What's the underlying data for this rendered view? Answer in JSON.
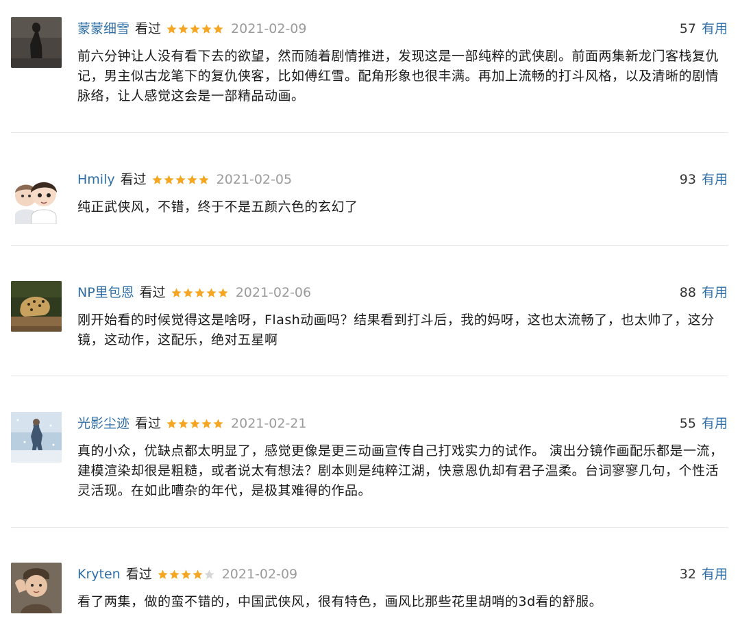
{
  "colors": {
    "link": "#2e6ea6",
    "date": "#9b9b9b",
    "star_on": "#f5a623",
    "star_off": "#d6d6d6"
  },
  "reviews": [
    {
      "username": "蒙蒙细雪",
      "status": "看过",
      "rating": 5,
      "date": "2021-02-09",
      "votes": "57",
      "useful_label": "有用",
      "content": "前六分钟让人没有看下去的欲望，然而随着剧情推进，发现这是一部纯粹的武侠剧。前面两集新龙门客栈复仇记，男主似古龙笔下的复仇侠客，比如傅红雪。配角形象也很丰满。再加上流畅的打斗风格，以及清晰的剧情脉络，让人感觉这会是一部精品动画。",
      "avatar_icon": "dark-figure-avatar"
    },
    {
      "username": "Hmily",
      "status": "看过",
      "rating": 5,
      "date": "2021-02-05",
      "votes": "93",
      "useful_label": "有用",
      "content": "纯正武侠风，不错，终于不是五颜六色的玄幻了",
      "avatar_icon": "cartoon-boys-avatar"
    },
    {
      "username": "NP里包恩",
      "status": "看过",
      "rating": 5,
      "date": "2021-02-06",
      "votes": "88",
      "useful_label": "有用",
      "content": "刚开始看的时候觉得这是啥呀，Flash动画吗？结果看到打斗后，我的妈呀，这也太流畅了，也太帅了，这分镜，这动作，这配乐，绝对五星啊",
      "avatar_icon": "cheetah-avatar"
    },
    {
      "username": "光影尘迹",
      "status": "看过",
      "rating": 5,
      "date": "2021-02-21",
      "votes": "55",
      "useful_label": "有用",
      "content": "真的小众，优缺点都太明显了，感觉更像是更三动画宣传自己打戏实力的试作。 演出分镜作画配乐都是一流，建模渲染却很是粗糙，或者说太有想法？剧本则是纯粹江湖，快意恩仇却有君子温柔。台词寥寥几句，个性活灵活现。在如此嘈杂的年代，是极其难得的作品。",
      "avatar_icon": "snow-painting-avatar"
    },
    {
      "username": "Kryten",
      "status": "看过",
      "rating": 4,
      "date": "2021-02-09",
      "votes": "32",
      "useful_label": "有用",
      "content": "看了两集，做的蛮不错的，中国武侠风，很有特色，画风比那些花里胡哨的3d看的舒服。",
      "avatar_icon": "child-saluting-avatar"
    }
  ]
}
